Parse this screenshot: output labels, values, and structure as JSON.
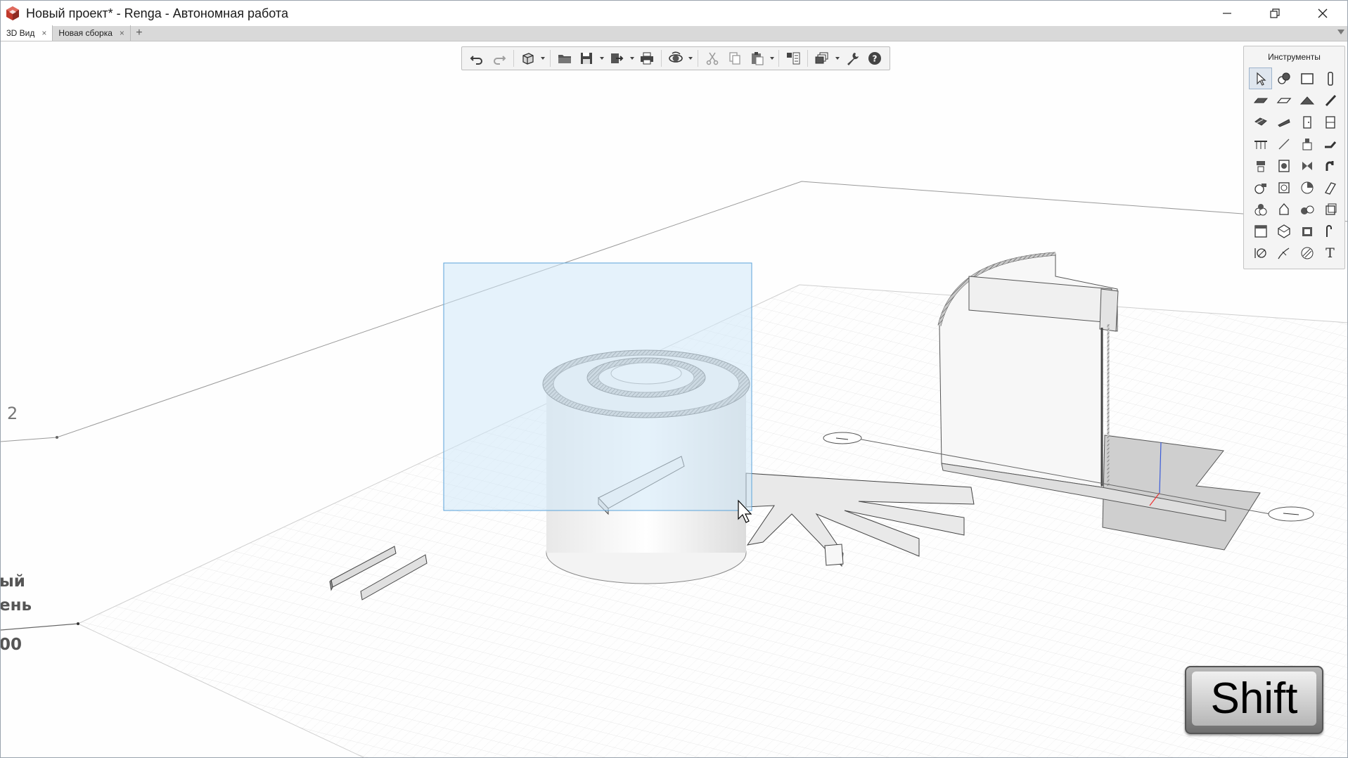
{
  "window": {
    "title": "Новый проект* - Renga - Автономная работа"
  },
  "tabs": [
    {
      "label": "3D Вид",
      "active": true
    },
    {
      "label": "Новая сборка",
      "active": false
    }
  ],
  "tab_close_glyph": "×",
  "tab_add_glyph": "+",
  "toolbar": {
    "buttons": [
      "undo-icon",
      "redo-icon",
      "view-cube-icon",
      "open-folder-icon",
      "save-icon",
      "export-icon",
      "print-icon",
      "orbit-icon",
      "cut-icon",
      "copy-icon",
      "paste-icon",
      "properties-panel-icon",
      "layers-icon",
      "wrench-icon",
      "help-icon"
    ]
  },
  "tools_panel": {
    "title": "Инструменты",
    "tools": [
      "select-icon",
      "assembly-icon",
      "wall-icon",
      "column-icon",
      "slab-icon",
      "floor-icon",
      "roof-icon",
      "beam-icon",
      "stair-icon",
      "ramp-icon",
      "door-icon",
      "window-icon",
      "railing-icon",
      "line-icon",
      "equipment-icon",
      "pipe-icon",
      "plumbing-icon",
      "boiler-icon",
      "valve-icon",
      "fitting-icon",
      "pump-icon",
      "radiator-icon",
      "fan-icon",
      "duct-icon",
      "electrical-icon",
      "light-icon",
      "switch-icon",
      "panel-icon",
      "room-icon",
      "model-icon",
      "cabinet-icon",
      "route-icon",
      "dimension-icon",
      "axis-icon",
      "hatch-icon",
      "text-icon"
    ],
    "text_tool_glyph": "T"
  },
  "viewport": {
    "level_labels": [
      {
        "text": "2"
      },
      {
        "text": "ый"
      },
      {
        "text": "ень"
      },
      {
        "text": "00"
      }
    ],
    "selection_color": "#cfe8f8"
  },
  "shift_key": {
    "label": "Shift"
  },
  "colors": {
    "accent": "#2b5797",
    "selection_border": "#5ba3d9",
    "logo_red": "#c0392b"
  }
}
